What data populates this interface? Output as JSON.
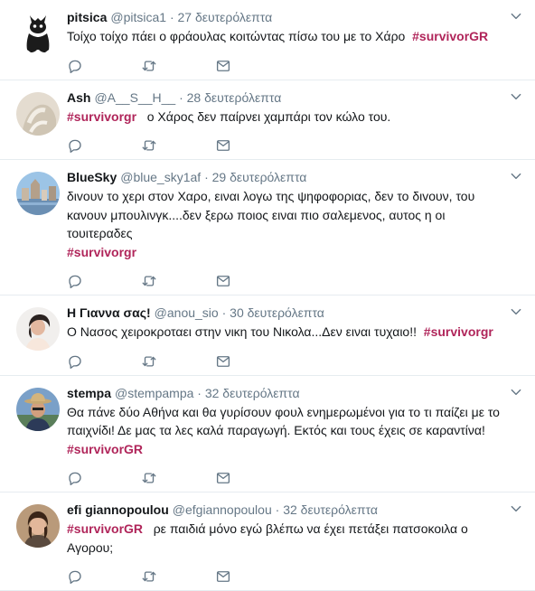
{
  "tweets": [
    {
      "name": "pitsica",
      "handle": "@pitsica1",
      "dot": "·",
      "time": "27 δευτερόλεπτα",
      "text": "Τοίχο τοίχο πάει ο φράουλας κοιτώντας πίσω του με το Χάρο",
      "tag": "#survivorGR",
      "tag_pos": "after"
    },
    {
      "name": "Ash",
      "handle": "@A__S__H__",
      "dot": "·",
      "time": "28 δευτερόλεπτα",
      "text": "ο Χάρος δεν παίρνει χαμπάρι τον κώλο του.",
      "tag": "#survivorgr",
      "tag_pos": "before"
    },
    {
      "name": "BlueSky",
      "handle": "@blue_sky1af",
      "dot": "·",
      "time": "29 δευτερόλεπτα",
      "text": "διvουν το χερι στον Χαρο, ειναι λογω της ψηφοφοριας, δεν το διvουν, του κανουν μπουλινγκ....δεν ξερω ποιος ειναι πιο σαλεμενος, αυτος η οι τουιτεραδες",
      "tag": "#survivorgr",
      "tag_pos": "newline"
    },
    {
      "name": "Η Γιαννα σας!",
      "handle": "@anou_sio",
      "dot": "·",
      "time": "30 δευτερόλεπτα",
      "text": "Ο Νασος χειροκροταει στην νικη του Νικολα...Δεν ειναι τυχαιο!!",
      "tag": "#survivorgr",
      "tag_pos": "after"
    },
    {
      "name": "stempa",
      "handle": "@stempampa",
      "dot": "·",
      "time": "32 δευτερόλεπτα",
      "text": "Θα πάνε δύο Αθήνα και θα γυρίσουν φουλ ενημερωμένοι για το τι παίζει με το παιχνίδι! Δε μας τα λες καλά παραγωγή. Εκτός και τους έχεις σε καραντίνα!",
      "tag": "#survivorGR",
      "tag_pos": "newline"
    },
    {
      "name": "efi giannopoulou",
      "handle": "@efgiannopoulou",
      "dot": "·",
      "time": "32 δευτερόλεπτα",
      "text": "ρε παιδιά μόνο εγώ βλέπω να έχει πετάξει πατσοκοιλα ο Αγορου;",
      "tag": "#survivorGR",
      "tag_pos": "before"
    }
  ],
  "icons": {
    "reply": "reply-icon",
    "retweet": "retweet-icon",
    "message": "message-icon",
    "caret": "chevron-down-icon"
  },
  "colors": {
    "hashtag": "#b0255a",
    "muted": "#657786",
    "divider": "#e6ecf0",
    "icon": "#657786"
  }
}
